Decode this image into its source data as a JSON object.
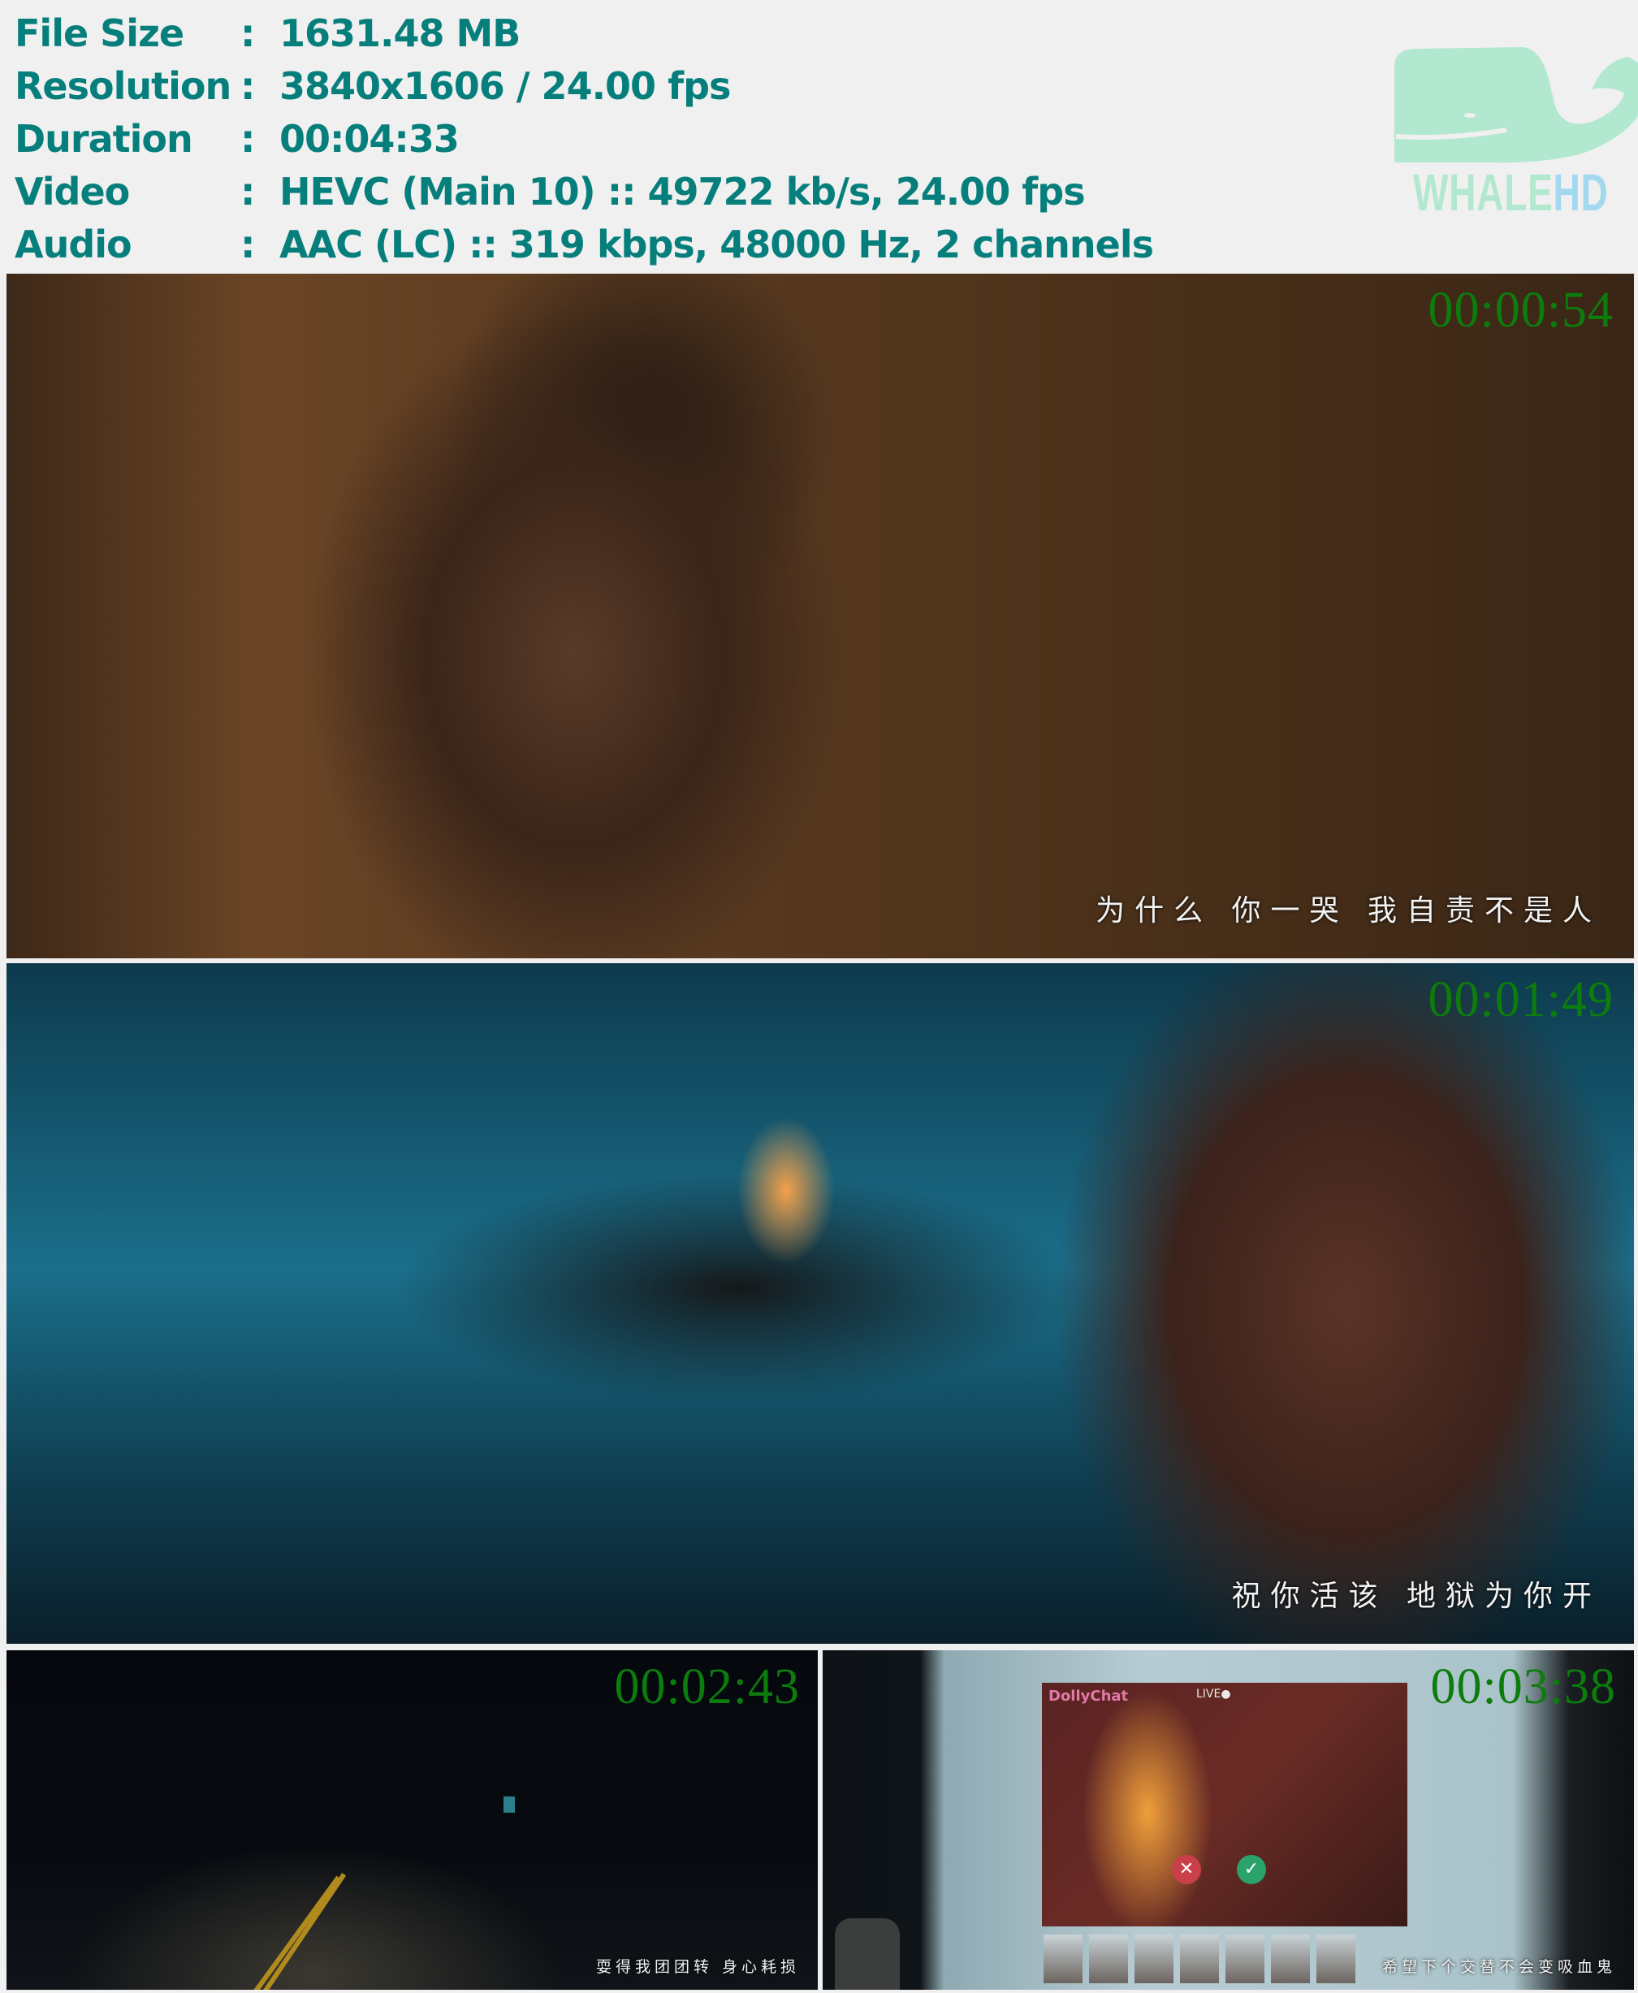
{
  "info": {
    "rows": [
      {
        "label": "File Size",
        "sep": ":",
        "value": "1631.48 MB"
      },
      {
        "label": "Resolution",
        "sep": ":",
        "value": "3840x1606 / 24.00 fps"
      },
      {
        "label": "Duration",
        "sep": ":",
        "value": "00:04:33"
      },
      {
        "label": "Video",
        "sep": ":",
        "value": "HEVC (Main 10) :: 49722 kb/s, 24.00 fps"
      },
      {
        "label": "Audio",
        "sep": ":",
        "value": "AAC (LC) :: 319 kbps, 48000 Hz, 2 channels"
      }
    ],
    "text_color": "#067f7c"
  },
  "logo": {
    "word1": "WHALE",
    "word2": "HD",
    "color1": "#b3e8d0",
    "color2": "#a3d8ef"
  },
  "frames": [
    {
      "timestamp": "00:00:54",
      "subtitle": "为什么  你一哭  我自责不是人"
    },
    {
      "timestamp": "00:01:49",
      "subtitle": "祝你活该  地狱为你开"
    },
    {
      "timestamp": "00:02:43",
      "subtitle": "耍得我团团转  身心耗损"
    },
    {
      "timestamp": "00:03:38",
      "subtitle": "希望下个交替不会变吸血鬼"
    }
  ],
  "frame4_screen": {
    "brand": "DollyChat",
    "live": "LIVE●"
  },
  "timestamp_color": "#0c7d0c"
}
